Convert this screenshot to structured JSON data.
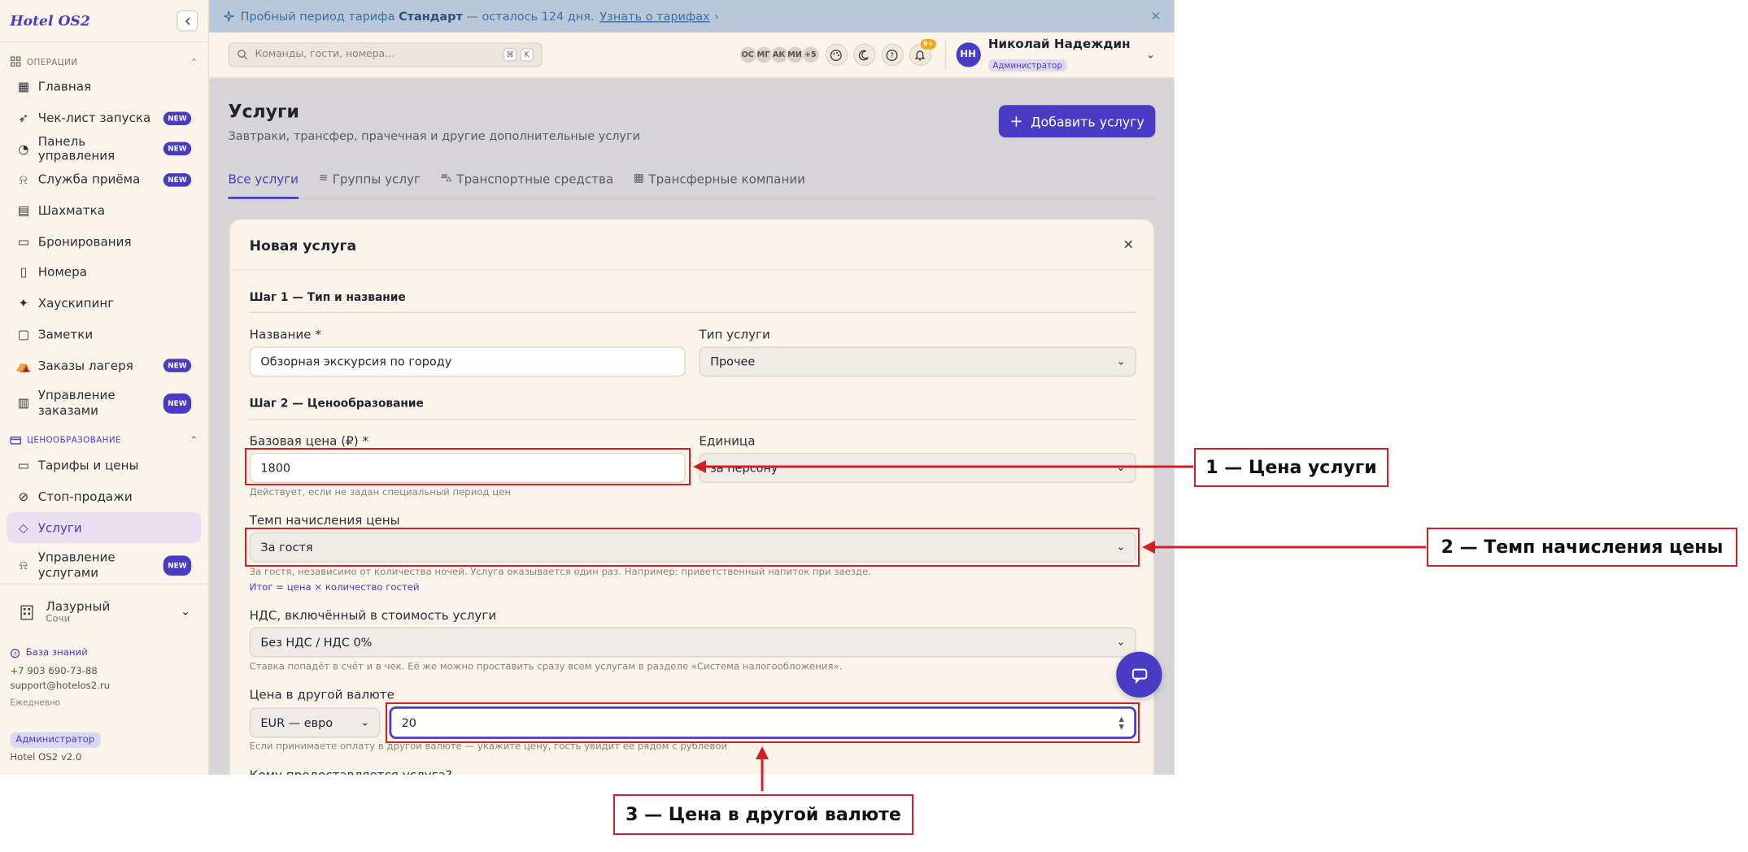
{
  "app": {
    "logo": "Hotel OS2"
  },
  "banner": {
    "prefix": "Пробный период тарифа",
    "plan": "Стандарт",
    "suffix": "— осталось 124 дня.",
    "link": "Узнать о тарифах"
  },
  "search": {
    "placeholder": "Команды, гости, номера...",
    "key1": "⌘",
    "key2": "K"
  },
  "presence": [
    "ОС",
    "МГ",
    "АК",
    "МИ",
    "+5"
  ],
  "notifications": {
    "count": "9+"
  },
  "user": {
    "initials": "НН",
    "name": "Николай Надеждин",
    "role": "Администратор"
  },
  "sidebar": {
    "sections": {
      "operations": "ОПЕРАЦИИ",
      "pricing": "ЦЕНООБРАЗОВАНИЕ"
    },
    "new_badge": "NEW",
    "items": [
      {
        "label": "Главная",
        "icon": "dashboard-icon",
        "new": false
      },
      {
        "label": "Чек-лист запуска",
        "icon": "rocket-icon",
        "new": true
      },
      {
        "label": "Панель управления",
        "icon": "gauge-icon",
        "new": true
      },
      {
        "label": "Служба приёма",
        "icon": "bell-icon",
        "new": true
      },
      {
        "label": "Шахматка",
        "icon": "grid-icon",
        "new": false
      },
      {
        "label": "Бронирования",
        "icon": "clipboard-icon",
        "new": false
      },
      {
        "label": "Номера",
        "icon": "door-icon",
        "new": false
      },
      {
        "label": "Хаускипинг",
        "icon": "sparkle-icon",
        "new": false
      },
      {
        "label": "Заметки",
        "icon": "note-icon",
        "new": false
      },
      {
        "label": "Заказы лагеря",
        "icon": "tent-icon",
        "new": true
      },
      {
        "label": "Управление заказами",
        "icon": "receipt-icon",
        "new": true
      }
    ],
    "pricing_items": [
      {
        "label": "Тарифы и цены",
        "icon": "card-icon"
      },
      {
        "label": "Стоп-продажи",
        "icon": "ban-icon"
      },
      {
        "label": "Услуги",
        "icon": "tag-icon",
        "active": true
      },
      {
        "label": "Управление услугами",
        "icon": "bell-icon",
        "new": true
      }
    ],
    "hotel": {
      "name": "Лазурный",
      "city": "Сочи"
    },
    "help": {
      "knowledge": "База знаний",
      "phone": "+7 903 690-73-88",
      "email": "support@hotelos2.ru",
      "schedule": "Ежедневно"
    },
    "role": "Администратор",
    "version": "Hotel OS2 v2.0"
  },
  "page": {
    "title": "Услуги",
    "subtitle": "Завтраки, трансфер, прачечная и другие дополнительные услуги",
    "add_button": "Добавить услугу",
    "tabs": [
      "Все услуги",
      "Группы услуг",
      "Транспортные средства",
      "Трансферные компании"
    ]
  },
  "modal": {
    "title": "Новая услуга",
    "step1": "Шаг 1 — Тип и название",
    "name_label": "Название *",
    "name_value": "Обзорная экскурсия по городу",
    "type_label": "Тип услуги",
    "type_value": "Прочее",
    "step2": "Шаг 2 — Ценообразование",
    "price_label": "Базовая цена (₽) *",
    "price_value": "1800",
    "price_hint": "Действует, если не задан специальный период цен",
    "unit_label": "Единица",
    "unit_value": "за персону",
    "rate_label": "Темп начисления цены",
    "rate_value": "За гостя",
    "rate_hint": "За гостя, независимо от количества ночей. Услуга оказывается один раз. Например: приветственный напиток при заезде.",
    "rate_formula": "Итог = цена × количество гостей",
    "vat_label": "НДС, включённый в стоимость услуги",
    "vat_value": "Без НДС / НДС 0%",
    "vat_hint": "Ставка попадёт в счёт и в чек. Её же можно проставить сразу всем услугам в разделе «Система налогообложения».",
    "currency_label": "Цена в другой валюте",
    "currency_value": "EUR — евро",
    "currency_amount": "20",
    "currency_hint": "Если принимаете оплату в другой валюте — укажите цену, гость увидит её рядом с рублевой",
    "next_label": "Кому предоставляется услуга?"
  },
  "annotations": {
    "c1": "1 — Цена услуги",
    "c2": "2 — Темп начисления цены",
    "c3": "3 — Цена в другой валюте",
    "color": "#d01f25"
  },
  "colors": {
    "accent": "#4a3bc4",
    "sidebar_bg": "#faf4ea",
    "banner_bg": "#b9c8d8"
  }
}
